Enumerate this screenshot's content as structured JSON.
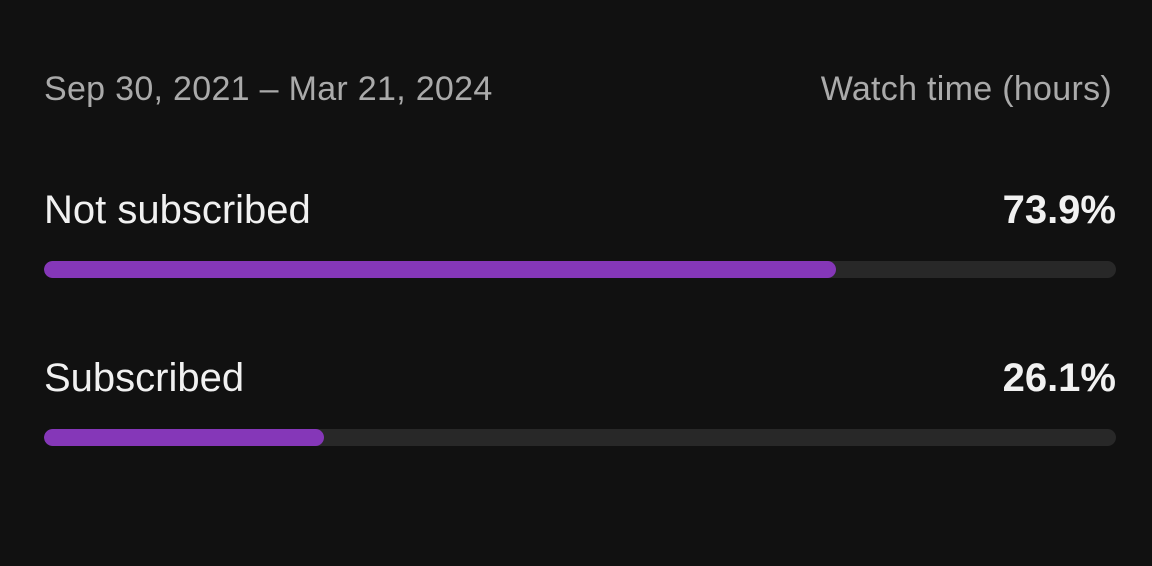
{
  "header": {
    "date_range": "Sep 30, 2021 – Mar 21, 2024",
    "metric": "Watch time (hours)"
  },
  "colors": {
    "background": "#111111",
    "bar_fill": "#8537b8",
    "bar_track": "#282828"
  },
  "rows": [
    {
      "label": "Not subscribed",
      "value_text": "73.9%",
      "percent": 73.9
    },
    {
      "label": "Subscribed",
      "value_text": "26.1%",
      "percent": 26.1
    }
  ]
}
